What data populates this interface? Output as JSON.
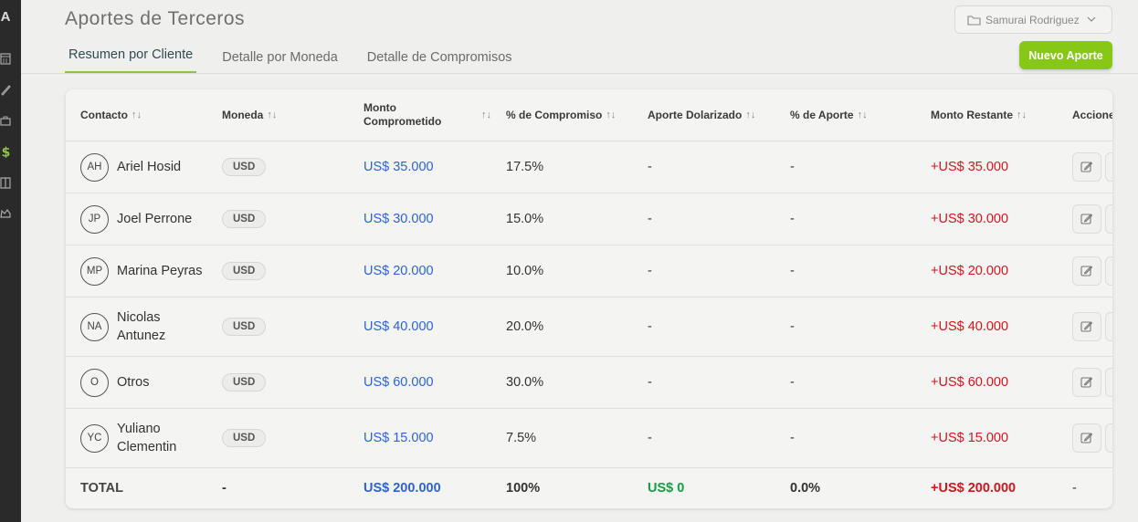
{
  "sidebar": {
    "logo": "A"
  },
  "header": {
    "title": "Aportes de Terceros",
    "user": "Samurai Rodriguez",
    "new_button": "Nuevo Aporte"
  },
  "tabs": [
    {
      "label": "Resumen por Cliente",
      "active": true
    },
    {
      "label": "Detalle por Moneda",
      "active": false
    },
    {
      "label": "Detalle de Compromisos",
      "active": false
    }
  ],
  "table": {
    "columns": {
      "contacto": "Contacto",
      "moneda": "Moneda",
      "monto_line1": "Monto",
      "monto_line2": "Comprometido",
      "pct_compromiso": "% de Compromiso",
      "aporte_dolarizado": "Aporte Dolarizado",
      "pct_aporte": "% de Aporte",
      "monto_restante": "Monto Restante",
      "acciones": "Acciones",
      "sort_glyph": "↑↓"
    },
    "rows": [
      {
        "initials": "AH",
        "name_line1": "Ariel Hosid",
        "name_line2": "",
        "currency": "USD",
        "committed": "US$ 35.000",
        "pct_commit": "17.5%",
        "dollarized": "-",
        "pct_contrib": "-",
        "remaining": "+US$ 35.000"
      },
      {
        "initials": "JP",
        "name_line1": "Joel Perrone",
        "name_line2": "",
        "currency": "USD",
        "committed": "US$ 30.000",
        "pct_commit": "15.0%",
        "dollarized": "-",
        "pct_contrib": "-",
        "remaining": "+US$ 30.000"
      },
      {
        "initials": "MP",
        "name_line1": "Marina Peyras",
        "name_line2": "",
        "currency": "USD",
        "committed": "US$ 20.000",
        "pct_commit": "10.0%",
        "dollarized": "-",
        "pct_contrib": "-",
        "remaining": "+US$ 20.000"
      },
      {
        "initials": "NA",
        "name_line1": "Nicolas",
        "name_line2": "Antunez",
        "currency": "USD",
        "committed": "US$ 40.000",
        "pct_commit": "20.0%",
        "dollarized": "-",
        "pct_contrib": "-",
        "remaining": "+US$ 40.000"
      },
      {
        "initials": "O",
        "name_line1": "Otros",
        "name_line2": "",
        "currency": "USD",
        "committed": "US$ 60.000",
        "pct_commit": "30.0%",
        "dollarized": "-",
        "pct_contrib": "-",
        "remaining": "+US$ 60.000"
      },
      {
        "initials": "YC",
        "name_line1": "Yuliano",
        "name_line2": "Clementin",
        "currency": "USD",
        "committed": "US$ 15.000",
        "pct_commit": "7.5%",
        "dollarized": "-",
        "pct_contrib": "-",
        "remaining": "+US$ 15.000"
      }
    ],
    "total": {
      "label": "TOTAL",
      "currency": "-",
      "committed": "US$ 200.000",
      "pct_commit": "100%",
      "dollarized": "US$ 0",
      "pct_contrib": "0.0%",
      "remaining": "+US$ 200.000",
      "actions": "-"
    }
  },
  "colors": {
    "accent_green": "#86c815",
    "amount_blue": "#2b64d8",
    "remaining_red": "#d4151f",
    "total_green": "#12a042"
  }
}
